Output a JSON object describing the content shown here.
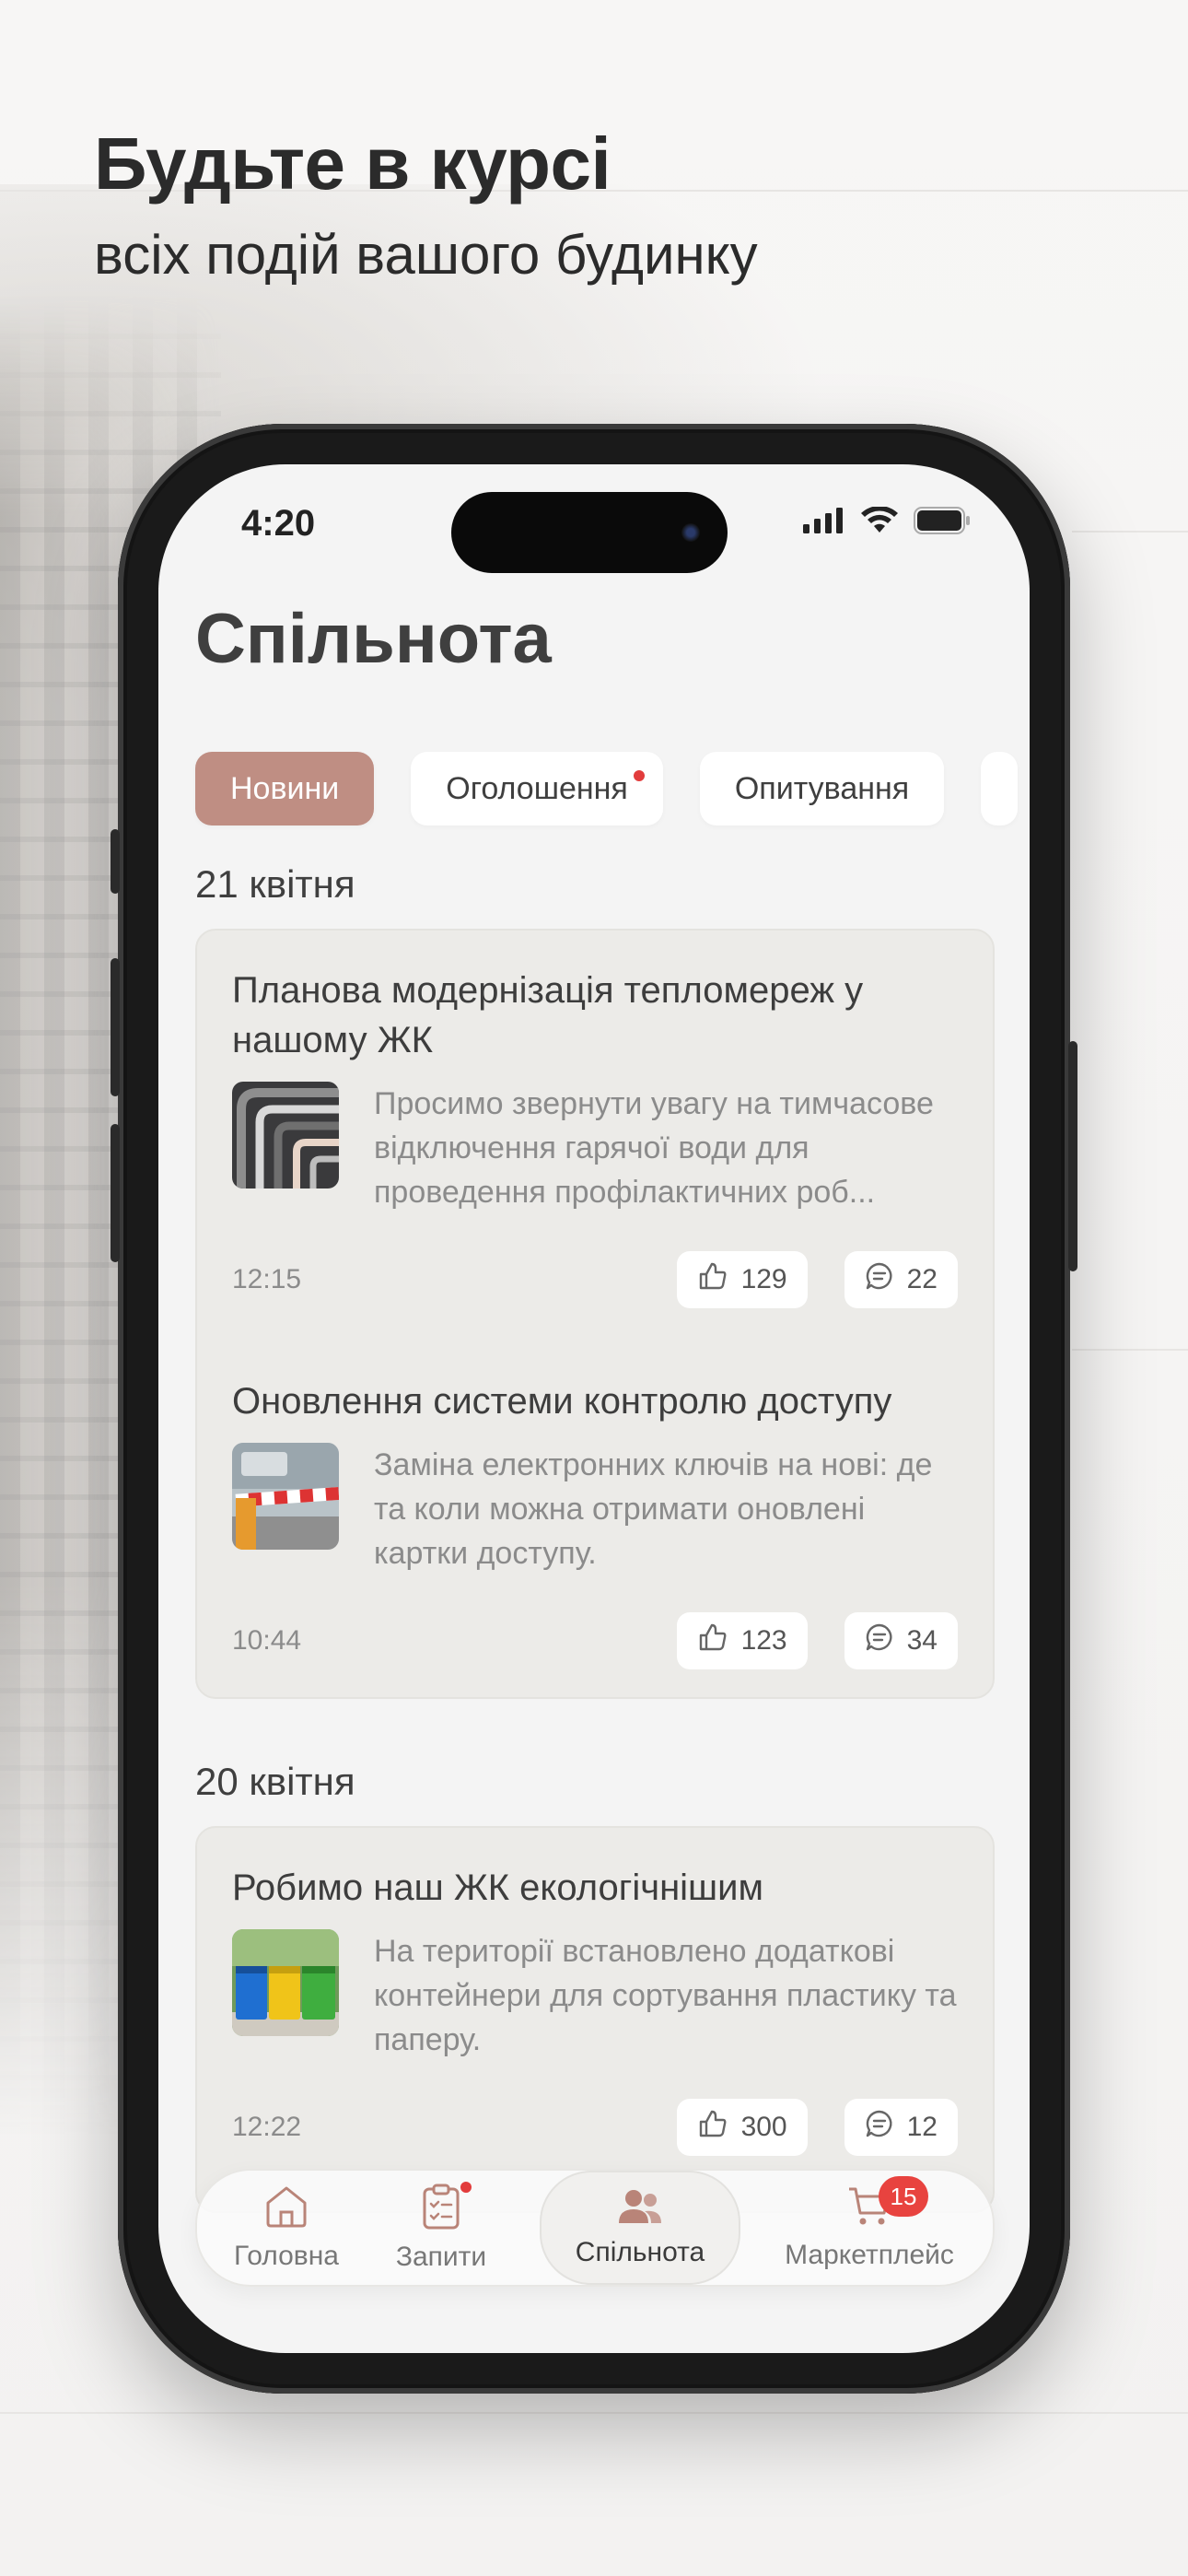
{
  "hero": {
    "title": "Будьте в курсі",
    "subtitle": "всіх подій вашого будинку"
  },
  "status_bar": {
    "time": "4:20"
  },
  "page": {
    "title": "Спільнота"
  },
  "tabs": [
    {
      "label": "Новини",
      "active": true
    },
    {
      "label": "Оголошення",
      "has_dot": true
    },
    {
      "label": "Опитування"
    }
  ],
  "sections": [
    {
      "date": "21 квітня",
      "posts": [
        {
          "title": "Планова модернізація тепломереж у нашому ЖК",
          "excerpt": "Просимо звернути увагу на тимчасове відключення гарячої води для проведення профілактичних роб...",
          "time": "12:15",
          "likes": "129",
          "comments": "22",
          "thumb_icon": "pipes-photo"
        },
        {
          "title": "Оновлення системи контролю доступу",
          "excerpt": "Заміна електронних ключів на нові: де та коли можна отримати оновлені картки доступу.",
          "time": "10:44",
          "likes": "123",
          "comments": "34",
          "thumb_icon": "barrier-photo"
        }
      ]
    },
    {
      "date": "20 квітня",
      "posts": [
        {
          "title": "Робимо наш ЖК екологічнішим",
          "excerpt": "На території встановлено додаткові контейнери для сортування пластику та паперу.",
          "time": "12:22",
          "likes": "300",
          "comments": "12",
          "thumb_icon": "recycling-bins-photo"
        }
      ]
    }
  ],
  "nav": {
    "items": [
      {
        "label": "Головна",
        "icon": "home-icon"
      },
      {
        "label": "Запити",
        "icon": "clipboard-icon",
        "has_dot": true
      },
      {
        "label": "Спільнота",
        "icon": "people-icon",
        "active": true
      },
      {
        "label": "Маркетплейс",
        "icon": "cart-icon",
        "badge": "15"
      }
    ]
  },
  "colors": {
    "accent": "#bf8e83",
    "badge": "#e8433f",
    "card_bg": "#ecebe8",
    "screen_bg": "#f4f4f4"
  }
}
